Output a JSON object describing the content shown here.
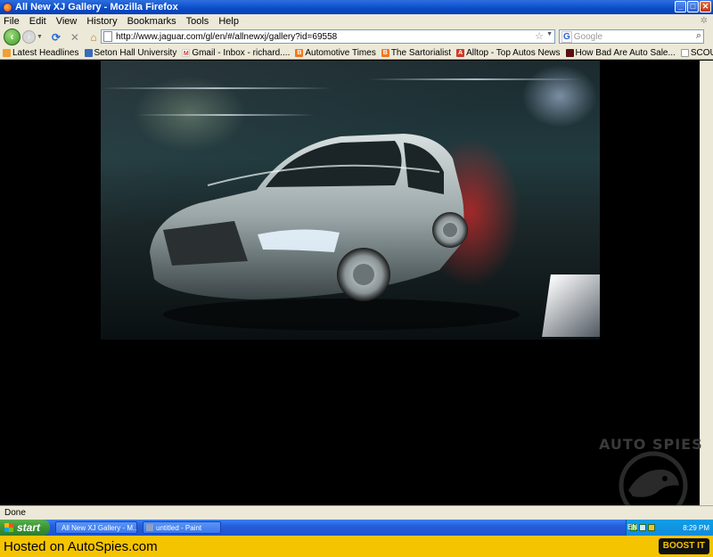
{
  "window": {
    "title": "All New XJ Gallery - Mozilla Firefox",
    "controls": {
      "minimize": "_",
      "maximize": "□",
      "close": "✕"
    }
  },
  "menubar": {
    "items": [
      "File",
      "Edit",
      "View",
      "History",
      "Bookmarks",
      "Tools",
      "Help"
    ]
  },
  "navbar": {
    "url": "http://www.jaguar.com/gl/en/#/allnewxj/gallery?id=69558",
    "search_placeholder": "Google",
    "icons": [
      "back-arrow-icon",
      "forward-arrow-icon",
      "reload-icon",
      "stop-icon",
      "home-icon",
      "star-icon",
      "search-icon"
    ]
  },
  "bookmarks": [
    {
      "label": "Latest Headlines",
      "icon": "rss-icon",
      "color": "#f0a030"
    },
    {
      "label": "Seton Hall University",
      "icon": "seton-hall-icon",
      "color": "#3a6ab8"
    },
    {
      "label": "Gmail - Inbox - richard....",
      "icon": "gmail-icon",
      "color": "#d03a2a"
    },
    {
      "label": "Automotive Times",
      "icon": "blogger-icon",
      "color": "#f07820"
    },
    {
      "label": "The Sartorialist",
      "icon": "blogger-icon",
      "color": "#f07820"
    },
    {
      "label": "Alltop - Top Autos News",
      "icon": "alltop-icon",
      "color": "#d03a2a"
    },
    {
      "label": "How Bad Are Auto Sale...",
      "icon": "page-icon",
      "color": "#5a1010"
    },
    {
      "label": "SCOUTING NY - www.s...",
      "icon": "page-icon",
      "color": "#cccccc"
    }
  ],
  "content": {
    "image_alt": "car-photo"
  },
  "watermark": {
    "text": "AUTO SPIES"
  },
  "statusbar": {
    "text": "Done"
  },
  "taskbar": {
    "start_label": "start",
    "tasks": [
      {
        "label": "All New XJ Gallery - M..."
      },
      {
        "label": "untitled - Paint"
      }
    ],
    "lang": "EN",
    "clock": "8:29 PM"
  },
  "footer": {
    "text": "Hosted on AutoSpies.com",
    "button_label": "BOOST IT"
  }
}
